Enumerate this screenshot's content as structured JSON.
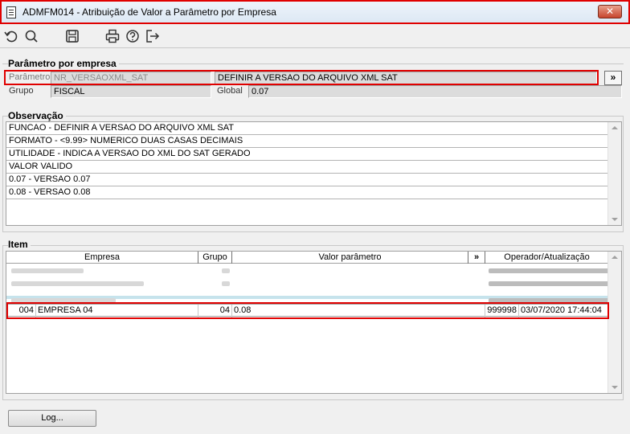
{
  "window": {
    "title": "ADMFM014 - Atribuição de Valor a Parâmetro por Empresa",
    "close_label": "✕"
  },
  "toolbar": {
    "icons": [
      "refresh-icon",
      "search-icon",
      "save-icon",
      "print-icon",
      "help-icon",
      "exit-icon"
    ]
  },
  "parametro_group": {
    "title": "Parâmetro por empresa",
    "parametro_label": "Parâmetro",
    "parametro_value": "NR_VERSAOXML_SAT",
    "descricao_value": "DEFINIR A VERSAO DO ARQUIVO XML SAT",
    "more_button": "»",
    "grupo_label": "Grupo",
    "grupo_value": "FISCAL",
    "global_label": "Global",
    "global_value": "0.07"
  },
  "observacao": {
    "title": "Observação",
    "lines": [
      "FUNCAO - DEFINIR A VERSAO DO ARQUIVO XML SAT",
      "FORMATO - <9.99> NUMERICO DUAS CASAS DECIMAIS",
      "UTILIDADE - INDICA A VERSAO DO XML DO SAT GERADO",
      "VALOR VALIDO",
      "0.07 - VERSAO 0.07",
      "0.08 - VERSAO 0.08"
    ]
  },
  "item": {
    "title": "Item",
    "columns": {
      "empresa": "Empresa",
      "grupo": "Grupo",
      "valor": "Valor parâmetro",
      "more": "»",
      "operador": "Operador/Atualização"
    },
    "selected_row": {
      "codigo": "004",
      "empresa": "EMPRESA 04",
      "grupo": "04",
      "valor": "0.08",
      "operador": "999998",
      "atualizacao": "03/07/2020 17:44:04"
    }
  },
  "footer": {
    "log_button": "Log..."
  },
  "colors": {
    "highlight": "#e00000",
    "field_bg": "#dcdcdc",
    "window_bg": "#f0f0f0"
  }
}
